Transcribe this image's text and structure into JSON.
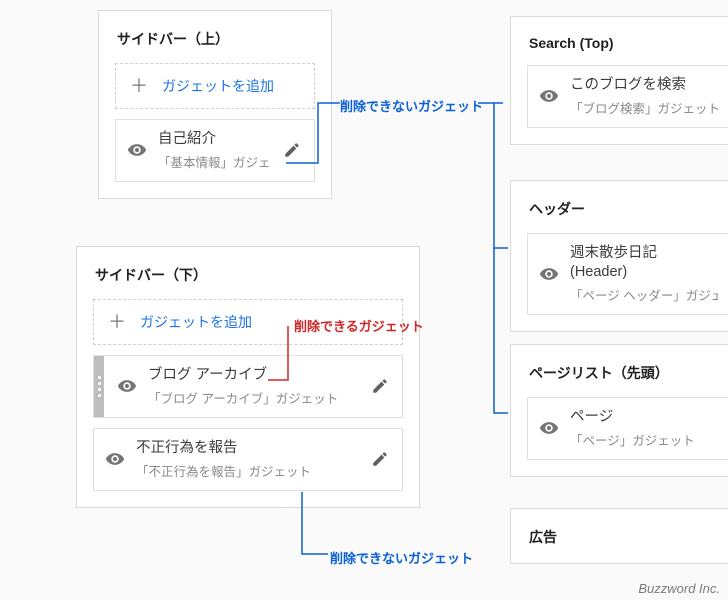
{
  "colors": {
    "link": "#1a73e8",
    "annoBlue": "#0a60d6",
    "annoRed": "#d02626"
  },
  "brand": "Buzzword Inc.",
  "annotations": {
    "cannot_delete_top": "削除できないガジェット",
    "can_delete": "削除できるガジェット",
    "cannot_delete_bottom": "削除できないガジェット"
  },
  "panels": {
    "sidebar_top": {
      "title": "サイドバー（上）",
      "add_label": "ガジェットを追加",
      "add_plus": "＋",
      "gadgets": [
        {
          "title": "自己紹介",
          "sub": "「基本情報」ガジェット",
          "editable": true,
          "draggable": false
        }
      ]
    },
    "sidebar_bottom": {
      "title": "サイドバー（下）",
      "add_label": "ガジェットを追加",
      "add_plus": "＋",
      "gadgets": [
        {
          "title": "ブログ アーカイブ",
          "sub": "「ブログ アーカイブ」ガジェット",
          "editable": true,
          "draggable": true
        },
        {
          "title": "不正行為を報告",
          "sub": "「不正行為を報告」ガジェット",
          "editable": true,
          "draggable": false
        }
      ]
    },
    "search_top": {
      "title": "Search (Top)",
      "gadgets": [
        {
          "title": "このブログを検索",
          "sub": "「ブログ検索」ガジェット",
          "editable": false,
          "draggable": false
        }
      ]
    },
    "header": {
      "title": "ヘッダー",
      "gadgets": [
        {
          "title": "週末散歩日記 (Header)",
          "sub": "「ページ ヘッダー」ガジェット",
          "editable": false,
          "draggable": false
        }
      ]
    },
    "pagelist": {
      "title": "ページリスト（先頭）",
      "gadgets": [
        {
          "title": "ページ",
          "sub": "「ページ」ガジェット",
          "editable": false,
          "draggable": false
        }
      ]
    },
    "ads": {
      "title": "広告"
    }
  }
}
